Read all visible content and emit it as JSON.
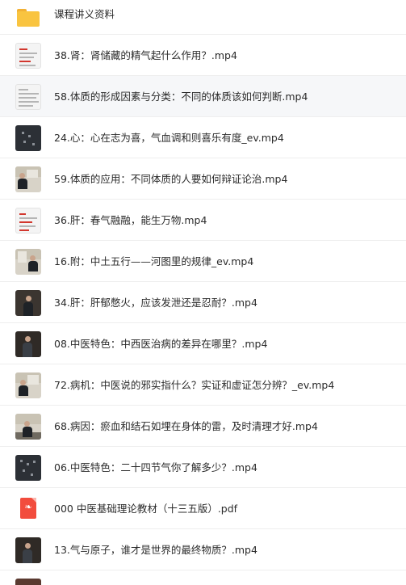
{
  "files": [
    {
      "name": "课程讲义资料",
      "icon": "folder-icon"
    },
    {
      "name": "38.肾：肾储藏的精气起什么作用？.mp4",
      "icon": "video-thumbnail"
    },
    {
      "name": "58.体质的形成因素与分类：不同的体质该如何判断.mp4",
      "icon": "video-thumbnail"
    },
    {
      "name": "24.心：心在志为喜，气血调和则喜乐有度_ev.mp4",
      "icon": "video-thumbnail"
    },
    {
      "name": "59.体质的应用：不同体质的人要如何辩证论治.mp4",
      "icon": "video-thumbnail"
    },
    {
      "name": "36.肝：春气融融，能生万物.mp4",
      "icon": "video-thumbnail"
    },
    {
      "name": "16.附：中土五行——河图里的规律_ev.mp4",
      "icon": "video-thumbnail"
    },
    {
      "name": "34.肝：肝郁憋火，应该发泄还是忍耐？.mp4",
      "icon": "video-thumbnail"
    },
    {
      "name": "08.中医特色：中西医治病的差异在哪里？.mp4",
      "icon": "video-thumbnail"
    },
    {
      "name": "72.病机：中医说的邪实指什么？实证和虚证怎分辨？_ev.mp4",
      "icon": "video-thumbnail"
    },
    {
      "name": "68.病因：瘀血和结石如埋在身体的雷，及时清理才好.mp4",
      "icon": "video-thumbnail"
    },
    {
      "name": "06.中医特色：二十四节气你了解多少？.mp4",
      "icon": "video-thumbnail"
    },
    {
      "name": "000 中医基础理论教材（十三五版）.pdf",
      "icon": "pdf-icon"
    },
    {
      "name": "13.气与原子，谁才是世界的最终物质？.mp4",
      "icon": "video-thumbnail"
    },
    {
      "name": "",
      "icon": "video-thumbnail"
    }
  ],
  "highlighted_index": 2,
  "colors": {
    "folder": "#f9c440",
    "pdf": "#f24c3d",
    "row_hover": "#f6f7f9",
    "text": "#2b2b2b"
  }
}
